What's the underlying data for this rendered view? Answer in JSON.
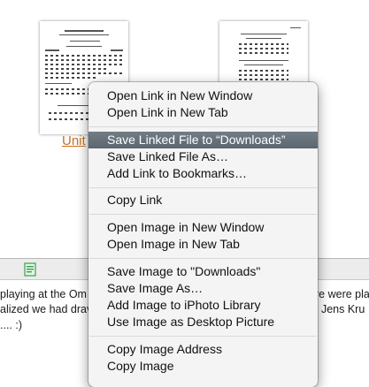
{
  "page": {
    "thumbnail_left_caption": "Unit",
    "paragraph_lines": [
      "playing at the Om",
      "alized we had drav",
      ".... :)"
    ],
    "paragraph_right_fragments": [
      "re were play",
      ". Jens Kru"
    ]
  },
  "context_menu": {
    "groups": [
      [
        {
          "label": "Open Link in New Window",
          "selected": false
        },
        {
          "label": "Open Link in New Tab",
          "selected": false
        }
      ],
      [
        {
          "label": "Save Linked File to “Downloads”",
          "selected": true
        },
        {
          "label": "Save Linked File As…",
          "selected": false
        },
        {
          "label": "Add Link to Bookmarks…",
          "selected": false
        }
      ],
      [
        {
          "label": "Copy Link",
          "selected": false
        }
      ],
      [
        {
          "label": "Open Image in New Window",
          "selected": false
        },
        {
          "label": "Open Image in New Tab",
          "selected": false
        }
      ],
      [
        {
          "label": "Save Image to \"Downloads\"",
          "selected": false
        },
        {
          "label": "Save Image As…",
          "selected": false
        },
        {
          "label": "Add Image to iPhoto Library",
          "selected": false
        },
        {
          "label": "Use Image as Desktop Picture",
          "selected": false
        }
      ],
      [
        {
          "label": "Copy Image Address",
          "selected": false
        },
        {
          "label": "Copy Image",
          "selected": false
        }
      ]
    ]
  },
  "colors": {
    "menu_highlight": "#66717a",
    "link": "#c8701f",
    "toolbar_icon": "#3a9f4a"
  }
}
